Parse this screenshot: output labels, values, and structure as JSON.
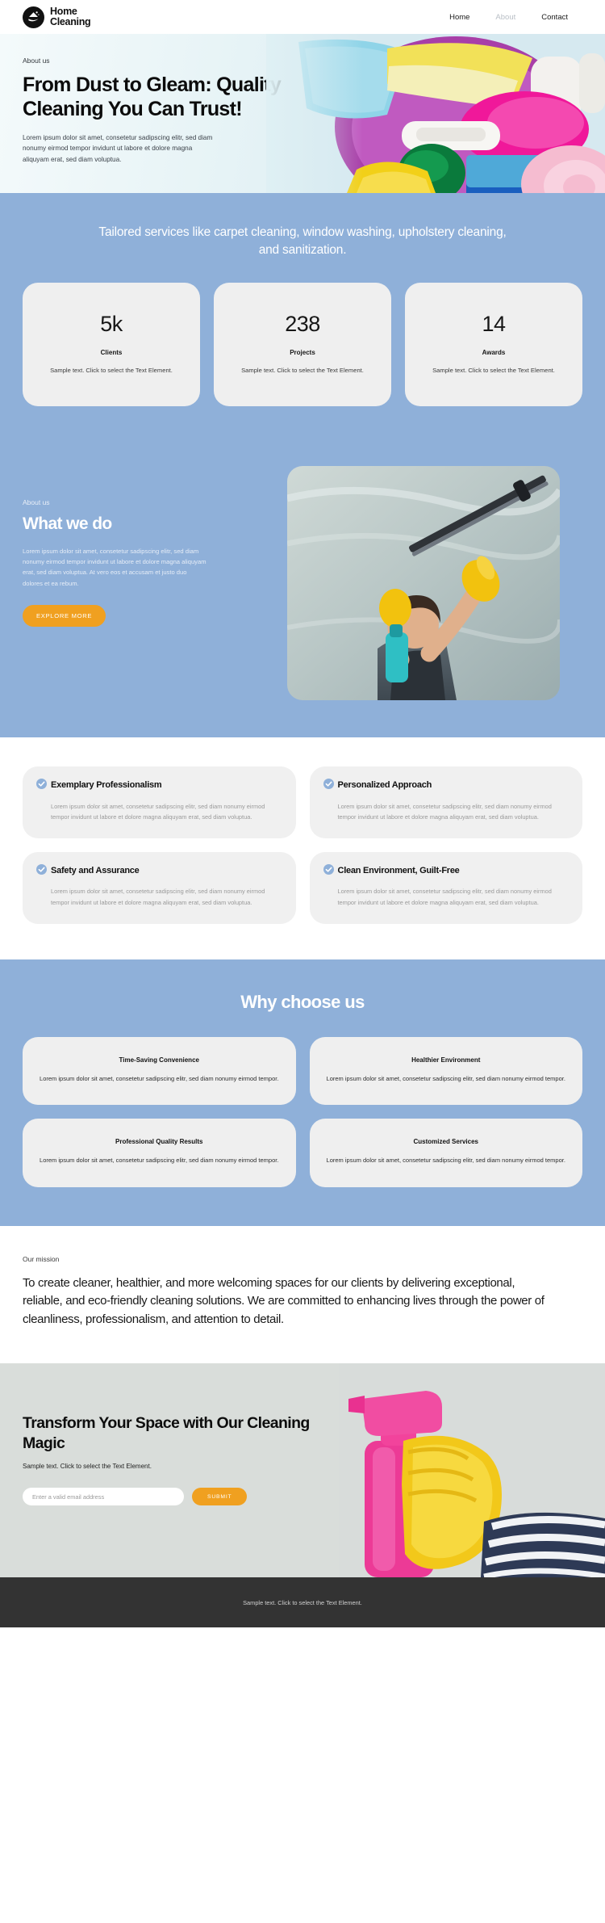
{
  "header": {
    "logo_line1": "Home",
    "logo_line2": "Cleaning",
    "logo_icon": "house-sparkle-icon",
    "nav": [
      {
        "label": "Home",
        "active": true
      },
      {
        "label": "About",
        "active": false
      },
      {
        "label": "Contact",
        "active": true
      }
    ]
  },
  "hero": {
    "eyebrow": "About us",
    "title": "From Dust to Gleam: Quality Cleaning You Can Trust!",
    "paragraph": "Lorem ipsum dolor sit amet, consetetur sadipscing elitr, sed diam nonumy eirmod tempor invidunt ut labore et dolore magna aliquyam erat, sed diam voluptua.",
    "image_alt": "bucket-of-cleaning-supplies-photo"
  },
  "stats_section": {
    "tagline": "Tailored services like carpet cleaning, window washing, upholstery cleaning, and sanitization.",
    "cards": [
      {
        "number": "5k",
        "label": "Clients",
        "desc": "Sample text. Click to select the Text Element."
      },
      {
        "number": "238",
        "label": "Projects",
        "desc": "Sample text. Click to select the Text Element."
      },
      {
        "number": "14",
        "label": "Awards",
        "desc": "Sample text. Click to select the Text Element."
      }
    ]
  },
  "what_we_do": {
    "eyebrow": "About us",
    "title": "What we do",
    "paragraph": "Lorem ipsum dolor sit amet, consetetur sadipscing elitr, sed diam nonumy eirmod tempor invidunt ut labore et dolore magna aliquyam erat, sed diam voluptua. At vero eos et accusam et justo duo dolores et ea rebum.",
    "button_label": "EXPLORE MORE",
    "image_alt": "person-squeegee-cleaning-window-photo"
  },
  "features": [
    {
      "icon": "check-circle-icon",
      "title": "Exemplary Professionalism",
      "desc": "Lorem ipsum dolor sit amet, consetetur sadipscing elitr, sed diam nonumy eirmod tempor invidunt ut labore et dolore magna aliquyam erat, sed diam voluptua."
    },
    {
      "icon": "check-circle-icon",
      "title": "Personalized Approach",
      "desc": "Lorem ipsum dolor sit amet, consetetur sadipscing elitr, sed diam nonumy eirmod tempor invidunt ut labore et dolore magna aliquyam erat, sed diam voluptua."
    },
    {
      "icon": "check-circle-icon",
      "title": "Safety and Assurance",
      "desc": "Lorem ipsum dolor sit amet, consetetur sadipscing elitr, sed diam nonumy eirmod tempor invidunt ut labore et dolore magna aliquyam erat, sed diam voluptua."
    },
    {
      "icon": "check-circle-icon",
      "title": "Clean Environment, Guilt-Free",
      "desc": "Lorem ipsum dolor sit amet, consetetur sadipscing elitr, sed diam nonumy eirmod tempor invidunt ut labore et dolore magna aliquyam erat, sed diam voluptua."
    }
  ],
  "why_choose_us": {
    "title": "Why choose us",
    "cards": [
      {
        "title": "Time-Saving Convenience",
        "desc": "Lorem ipsum dolor sit amet, consetetur sadipscing elitr, sed diam nonumy eirmod tempor."
      },
      {
        "title": "Healthier Environment",
        "desc": "Lorem ipsum dolor sit amet, consetetur sadipscing elitr, sed diam nonumy eirmod tempor."
      },
      {
        "title": "Professional Quality Results",
        "desc": "Lorem ipsum dolor sit amet, consetetur sadipscing elitr, sed diam nonumy eirmod tempor."
      },
      {
        "title": "Customized Services",
        "desc": "Lorem ipsum dolor sit amet, consetetur sadipscing elitr, sed diam nonumy eirmod tempor."
      }
    ]
  },
  "mission": {
    "eyebrow": "Our mission",
    "text": "To create cleaner, healthier, and more welcoming spaces for our clients by delivering exceptional, reliable, and eco-friendly cleaning solutions. We are committed to enhancing lives through the power of cleanliness, professionalism, and attention to detail."
  },
  "cta": {
    "title": "Transform Your Space with Our Cleaning Magic",
    "subtitle": "Sample text. Click to select the Text Element.",
    "email_placeholder": "Enter a valid email address",
    "email_value": "",
    "submit_label": "SUBMIT",
    "image_alt": "gloved-hand-holding-pink-spray-bottle-photo"
  },
  "footer": {
    "text": "Sample text. Click to select the Text Element."
  },
  "colors": {
    "brand_blue": "#8fb0d9",
    "accent_orange": "#f0a020",
    "card_grey": "#efefef",
    "footer_dark": "#333333",
    "check_blue": "#8fb0d9"
  }
}
